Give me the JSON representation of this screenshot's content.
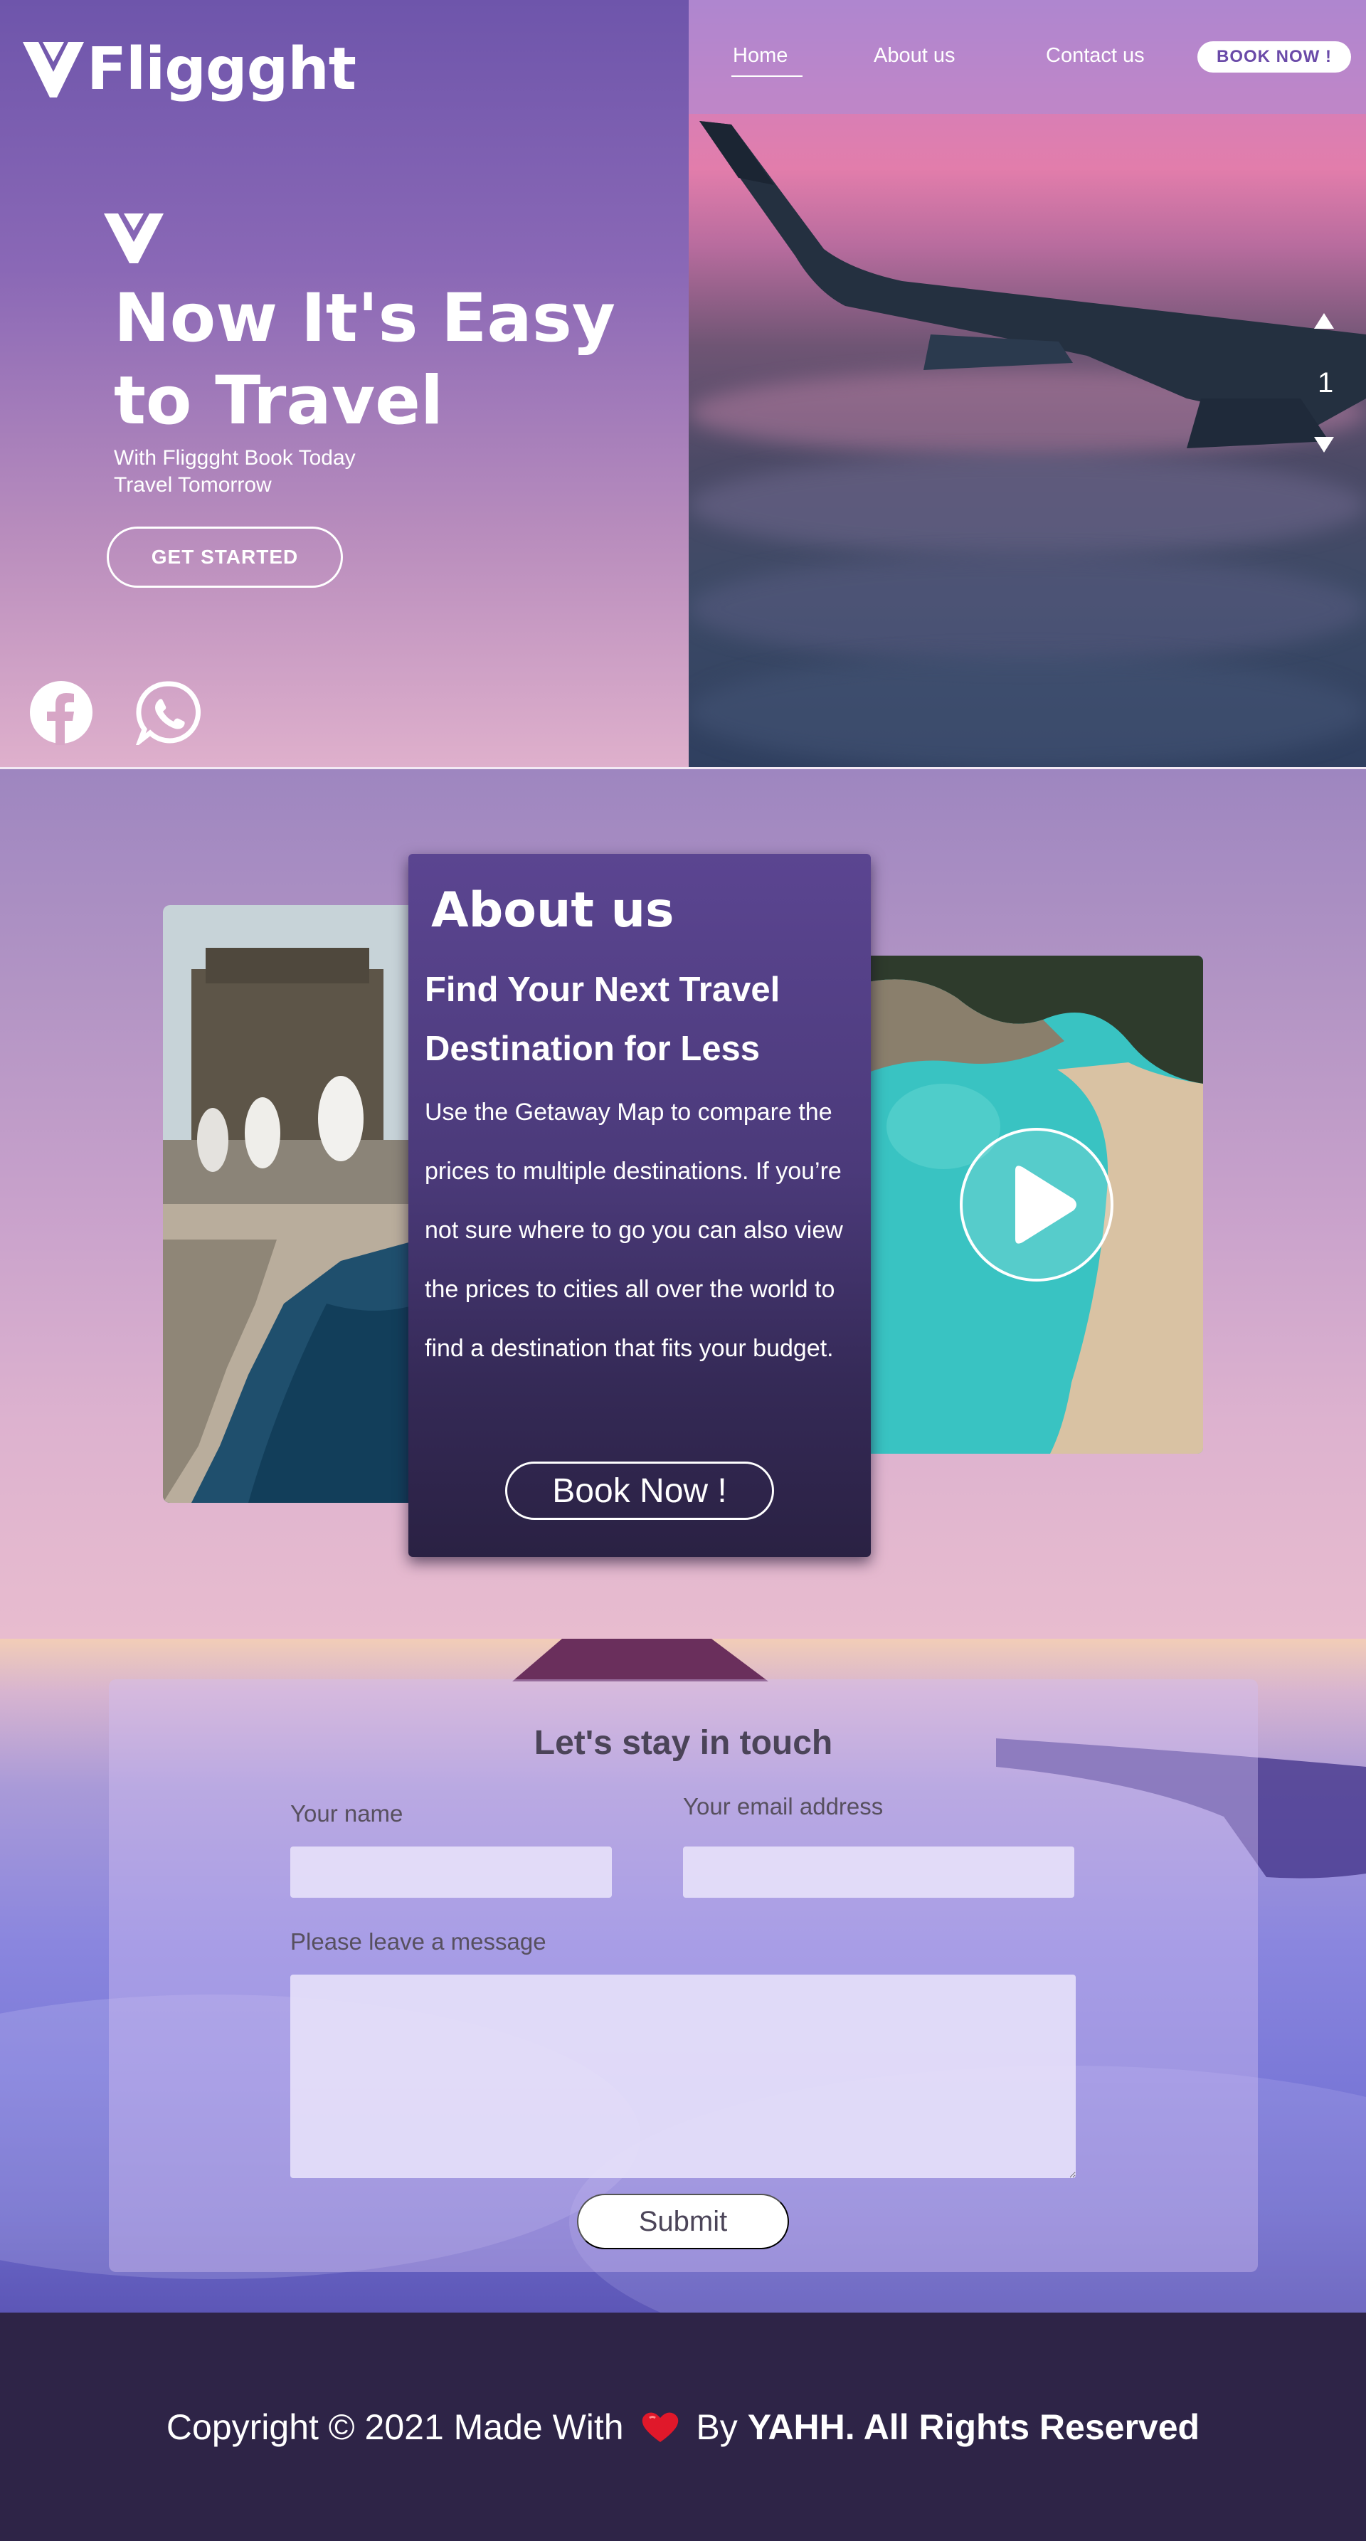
{
  "brand": {
    "name": "Fliggght"
  },
  "nav": {
    "home": "Home",
    "about": "About us",
    "contact": "Contact us",
    "book": "BOOK NOW !"
  },
  "hero": {
    "title_line1": "Now It's Easy",
    "title_line2": "to Travel",
    "subtitle_line1": "With Fliggght Book Today",
    "subtitle_line2": "Travel Tomorrow",
    "cta": "GET STARTED",
    "slide_number": "1"
  },
  "social": {
    "icons": [
      "facebook-icon",
      "whatsapp-icon"
    ]
  },
  "about": {
    "title": "About us",
    "headline": "Find Your Next Travel Destination for Less",
    "body": "Use the Getaway Map to compare the prices to multiple destinations. If you’re not sure where to go you can also view the prices to cities all over the world to find a destination that fits your budget.",
    "cta": "Book Now !"
  },
  "contact": {
    "title": "Let's stay in touch",
    "name_label": "Your name",
    "email_label": "Your email address",
    "message_label": "Please leave a message",
    "submit": "Submit"
  },
  "footer": {
    "prefix": "Copyright © 2021 Made With",
    "by": "By",
    "suffix": "YAHH. All Rights Reserved"
  },
  "colors": {
    "brand_purple": "#6a4aa8",
    "card_dark": "#2a2143",
    "footer_bg": "#2e2447",
    "heart": "#e0182a"
  }
}
